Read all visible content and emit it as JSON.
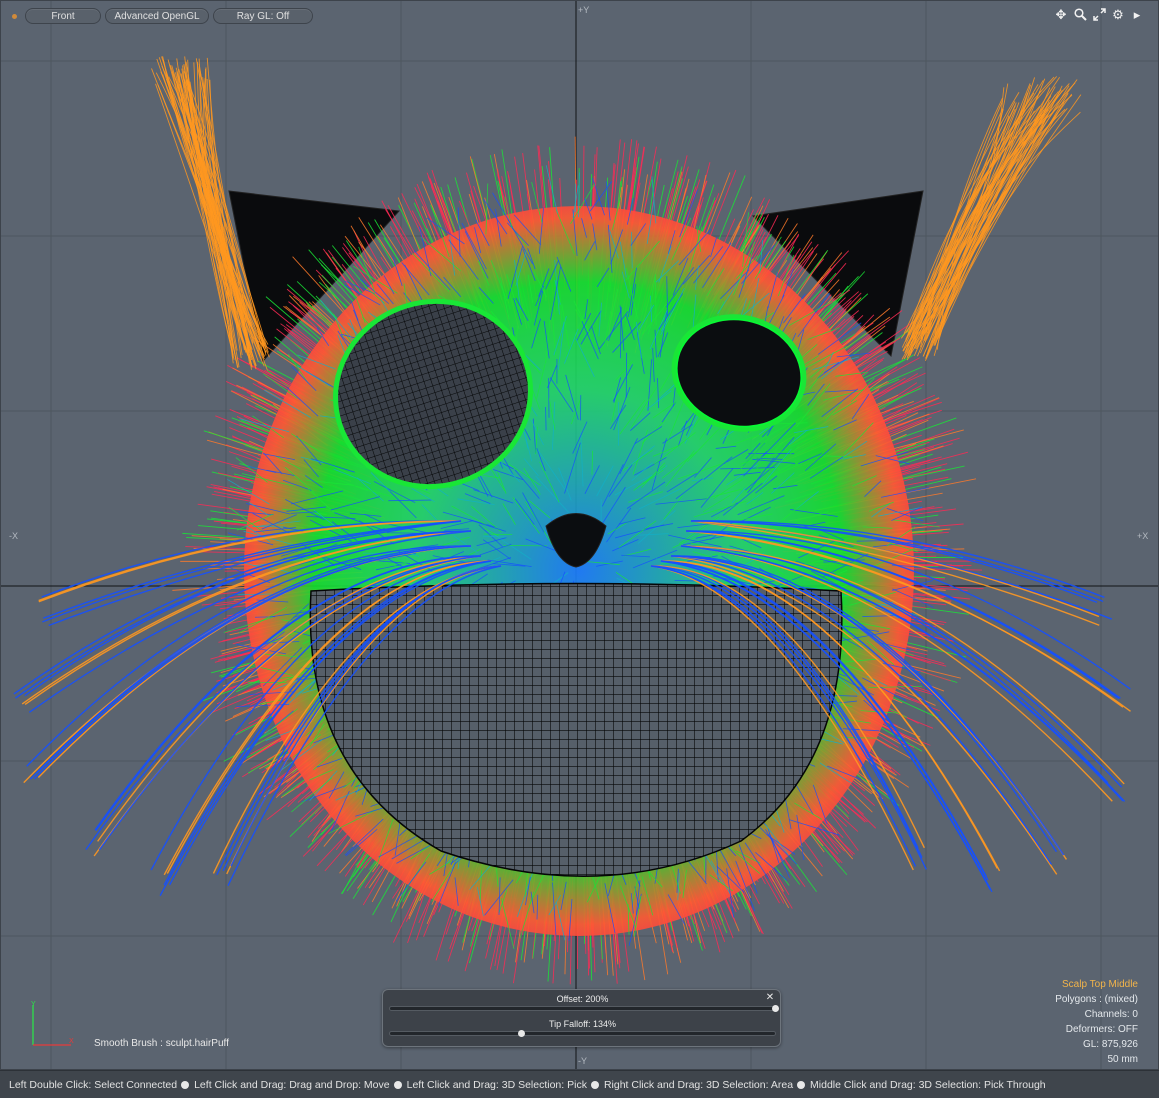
{
  "viewport": {
    "view_button": "Front",
    "render_button": "Advanced OpenGL",
    "raygl_button": "Ray GL: Off",
    "axis_labels": {
      "top": "+Y",
      "bottom": "-Y",
      "left": "-X",
      "right": "+X"
    },
    "icons": [
      "move-view-icon",
      "zoom-icon",
      "maximize-icon",
      "gear-icon",
      "arrow-right-icon"
    ],
    "info": {
      "item": "Scalp Top Middle",
      "polygons": "Polygons : (mixed)",
      "channels": "Channels: 0",
      "deformers": "Deformers: OFF",
      "gl": "GL: 875,926",
      "scale": "50 mm"
    },
    "tool_label": "Smooth Brush : sculpt.hairPuff",
    "colors": {
      "background": "#5b6470",
      "grid": "#4e565f",
      "hair_root": "#ff2a55",
      "hair_mid": "#19e636",
      "hair_tip": "#1550ff",
      "guide": "#ff9820",
      "wire": "#000000"
    }
  },
  "tool_popup": {
    "offset_label": "Offset: 200%",
    "offset_value": 1.0,
    "tip_falloff_label": "Tip Falloff: 134%",
    "tip_falloff_value": 0.34,
    "close_glyph": "✕"
  },
  "statusbar": {
    "items": [
      "Left Double Click: Select Connected",
      "Left Click and Drag: Drag and Drop: Move",
      "Left Click and Drag: 3D Selection: Pick",
      "Right Click and Drag: 3D Selection: Area",
      "Middle Click and Drag: 3D Selection: Pick Through"
    ]
  }
}
